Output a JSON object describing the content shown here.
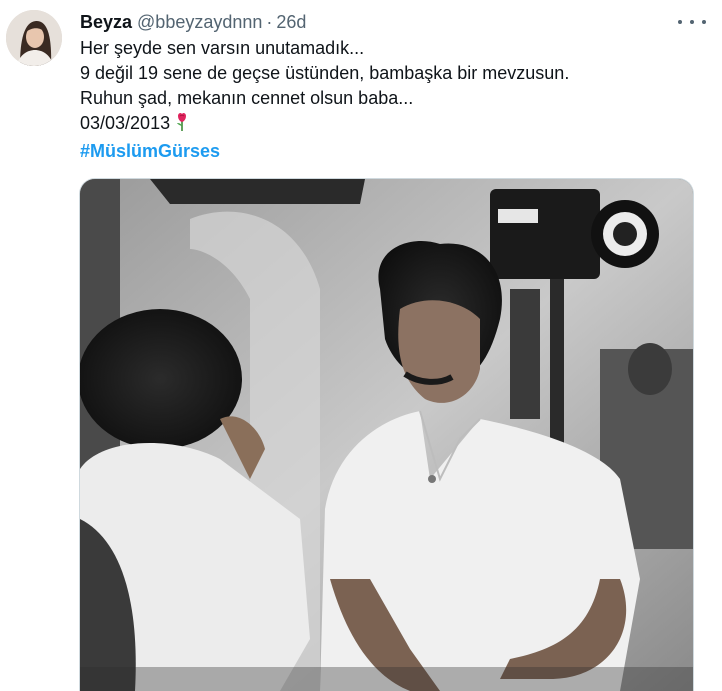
{
  "tweet": {
    "display_name": "Beyza",
    "handle": "@bbeyzaydnnn",
    "separator": "·",
    "time": "26d",
    "lines": [
      "Her şeyde sen varsın unutamadık...",
      "9 değil 19 sene de geçse üstünden, bambaşka bir mevzusun.",
      "Ruhun şad, mekanın cennet olsun baba...",
      "03/03/2013"
    ],
    "emoji": "rose-icon",
    "hashtag": "#MüslümGürses",
    "more_icon": "more-horizontal-icon"
  },
  "colors": {
    "text": "#0f1419",
    "muted": "#536471",
    "link": "#1d9bf0"
  }
}
